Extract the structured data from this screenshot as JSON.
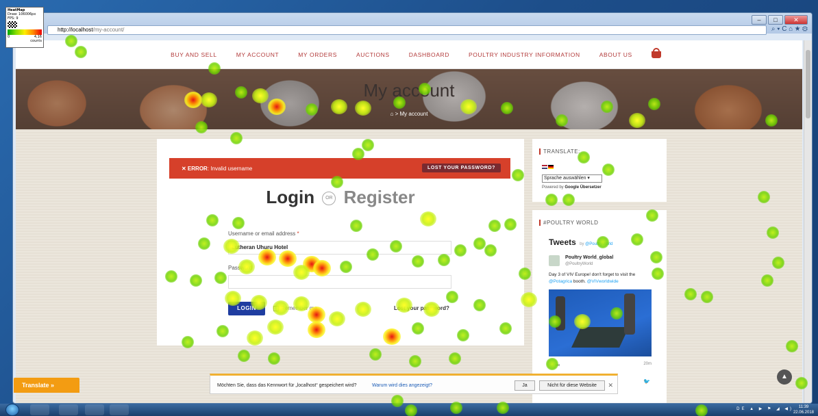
{
  "heatmap_legend": {
    "title": "HeatMap",
    "line2": "Draw: 106006px",
    "line3": "FPS: 9",
    "min": "0",
    "max": "4,16",
    "unit": "counts"
  },
  "browser": {
    "host": "http://localhost",
    "path": "/my-account/",
    "tools": "⌕ ▾ C  ⌂ ★ ⚙"
  },
  "window_controls": {
    "minimize": "–",
    "maximize": "□",
    "close": "✕"
  },
  "nav": {
    "items": [
      "BUY AND SELL",
      "MY ACCOUNT",
      "MY ORDERS",
      "AUCTIONS",
      "DASHBOARD",
      "POULTRY INDUSTRY INFORMATION",
      "ABOUT US"
    ]
  },
  "hero": {
    "title": "My account",
    "breadcrumb": "⌂ > My account"
  },
  "error": {
    "label": "✕ ERROR",
    "message": ": Invalid username",
    "lost_button": "LOST YOUR PASSWORD?"
  },
  "login": {
    "login_word": "Login",
    "or_word": "OR",
    "register_word": "Register",
    "username_label": "Username or email address",
    "required_mark": "*",
    "username_value": "Lutheran Uhuru Hotel",
    "password_label": "Password",
    "login_button": "LOGIN",
    "remember": "Remember me",
    "lost_link": "Lost your password?"
  },
  "translate_widget": {
    "title": "TRANSLATE:",
    "select_value": "Sprache auswählen ▾",
    "powered_prefix": "Powered by ",
    "powered_brand": "Google Übersetzer"
  },
  "poultry_widget": {
    "title": "#POULTRY WORLD",
    "tweets": "Tweets",
    "tweets_by": "by ",
    "tweets_handle": "@PoultryWorld",
    "tweet_name": "Poultry World_global",
    "tweet_handle": "@PoultryWorld",
    "tweet_text_1": "Day 3 of VIV Europe! don't forget to visit the ",
    "tweet_hl_1": "@Potagrica",
    "tweet_text_2": " booth. ",
    "tweet_hl_2": "@VIVworldwide",
    "tweet_actions": "♡  ⇥",
    "tweet_time": "20m",
    "share": "🐦"
  },
  "translate_button": "Translate »",
  "to_top": "▲",
  "password_bar": {
    "question": "Möchten Sie, dass das Kennwort für „localhost“ gespeichert wird?",
    "why": "Warum wird dies angezeigt?",
    "yes": "Ja",
    "no": "Nicht für diese Website",
    "close": "✕"
  },
  "taskbar": {
    "tray": "DE ▲ ▶ ⚑ ◢ ◀)",
    "time": "11:39",
    "date": "22.06.2018"
  }
}
